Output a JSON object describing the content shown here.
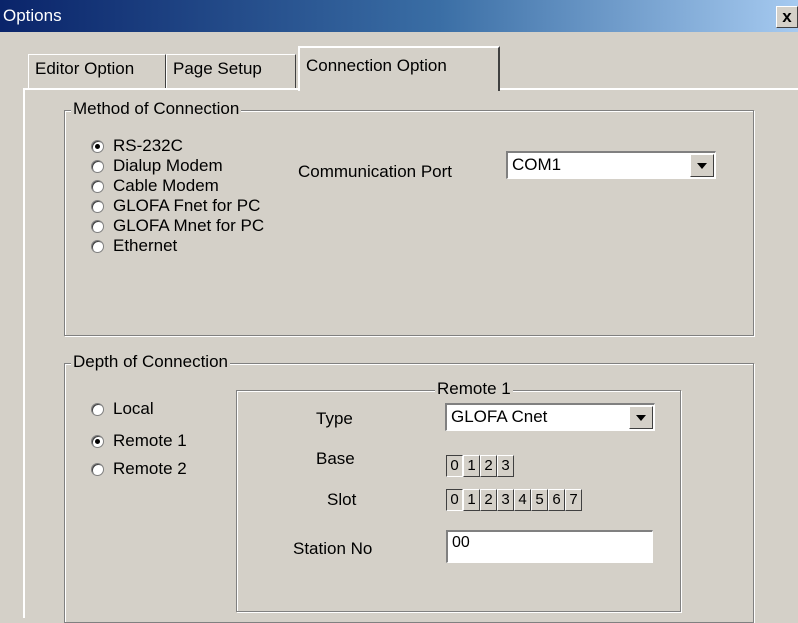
{
  "window": {
    "title": "Options",
    "close_glyph": "x"
  },
  "tabs": [
    {
      "label": "Editor Option"
    },
    {
      "label": "Page Setup"
    },
    {
      "label": "Connection Option"
    }
  ],
  "method": {
    "title": "Method of Connection",
    "options": [
      "RS-232C",
      "Dialup Modem",
      "Cable Modem",
      "GLOFA Fnet for PC",
      "GLOFA Mnet for PC",
      "Ethernet"
    ],
    "selected": "RS-232C",
    "port_label": "Communication Port",
    "port_value": "COM1"
  },
  "depth": {
    "title": "Depth of Connection",
    "options": [
      "Local",
      "Remote 1",
      "Remote 2"
    ],
    "selected": "Remote 1",
    "remote": {
      "title": "Remote 1",
      "type_label": "Type",
      "type_value": "GLOFA Cnet",
      "base_label": "Base",
      "base_buttons": [
        "0",
        "1",
        "2",
        "3"
      ],
      "base_selected": "0",
      "slot_label": "Slot",
      "slot_buttons": [
        "0",
        "1",
        "2",
        "3",
        "4",
        "5",
        "6",
        "7"
      ],
      "slot_selected": "0",
      "station_label": "Station No",
      "station_value": "00"
    }
  }
}
